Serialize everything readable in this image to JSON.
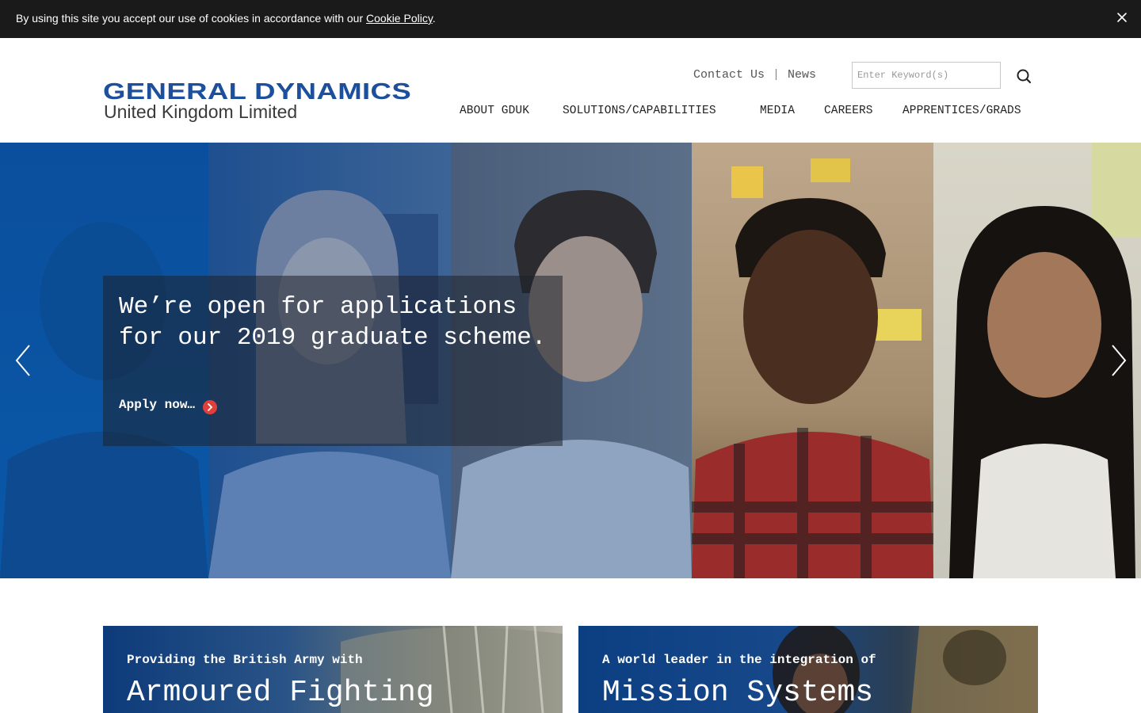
{
  "cookie_bar": {
    "text": "By using this site you accept our use of cookies in accordance with our ",
    "link_label": "Cookie Policy",
    "trailing": "."
  },
  "brand": {
    "name": "GENERAL DYNAMICS",
    "subtitle": "United Kingdom Limited",
    "color": "#1c4f9c"
  },
  "utility_nav": {
    "contact": "Contact Us",
    "separator": "|",
    "news": "News"
  },
  "search": {
    "placeholder": "Enter Keyword(s)",
    "value": ""
  },
  "main_nav": [
    {
      "label": "ABOUT GDUK"
    },
    {
      "label": "SOLUTIONS/CAPABILITIES"
    },
    {
      "label": "MEDIA"
    },
    {
      "label": "CAREERS"
    },
    {
      "label": "APPRENTICES/GRADS"
    }
  ],
  "hero": {
    "heading": "We’re open for applications for our 2019 graduate scheme.",
    "cta_label": "Apply now…",
    "cta_color": "#e0403c"
  },
  "cards": [
    {
      "kicker": "Providing the British Army with",
      "title": "Armoured Fighting"
    },
    {
      "kicker": "A world leader in the integration of",
      "title": "Mission Systems"
    }
  ]
}
